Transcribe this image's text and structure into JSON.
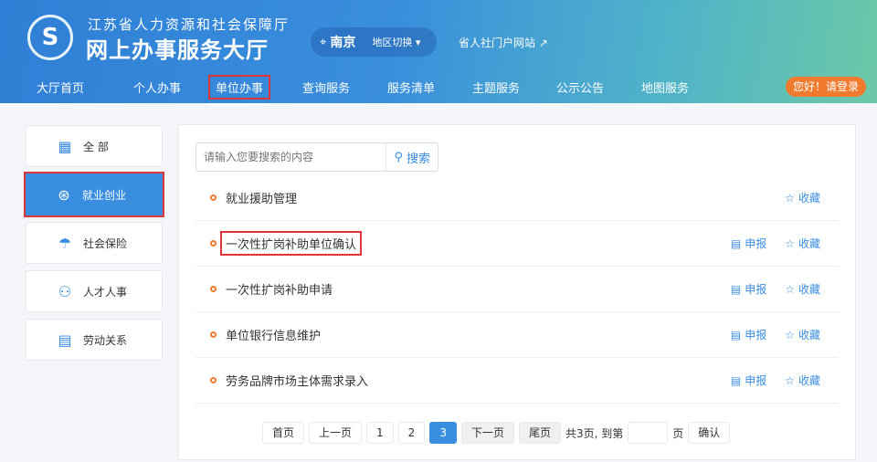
{
  "header": {
    "org": "江苏省人力资源和社会保障厅",
    "title": "网上办事服务大厅",
    "city": "南京",
    "switch": "地区切换 ▾",
    "portal": "省人社门户网站 ↗",
    "login": "您好！请登录"
  },
  "nav": [
    "大厅首页",
    "个人办事",
    "单位办事",
    "查询服务",
    "服务清单",
    "主题服务",
    "公示公告",
    "地图服务"
  ],
  "sidebar": [
    {
      "label": "全 部",
      "icon": "grid-icon"
    },
    {
      "label": "就业创业",
      "icon": "employment-icon"
    },
    {
      "label": "社会保险",
      "icon": "umbrella-icon"
    },
    {
      "label": "人才人事",
      "icon": "people-icon"
    },
    {
      "label": "劳动关系",
      "icon": "document-icon"
    }
  ],
  "search": {
    "placeholder": "请输入您要搜索的内容",
    "button": "搜索"
  },
  "items": [
    {
      "name": "就业援助管理",
      "apply": false
    },
    {
      "name": "一次性扩岗补助单位确认",
      "apply": true
    },
    {
      "name": "一次性扩岗补助申请",
      "apply": true
    },
    {
      "name": "单位银行信息维护",
      "apply": true
    },
    {
      "name": "劳务品牌市场主体需求录入",
      "apply": true
    }
  ],
  "actions": {
    "apply": "申报",
    "fav": "收藏"
  },
  "pager": {
    "first": "首页",
    "prev": "上一页",
    "pages": [
      "1",
      "2",
      "3"
    ],
    "next": "下一页",
    "last": "尾页",
    "total": "共3页, 到第",
    "unit": "页",
    "confirm": "确认"
  }
}
